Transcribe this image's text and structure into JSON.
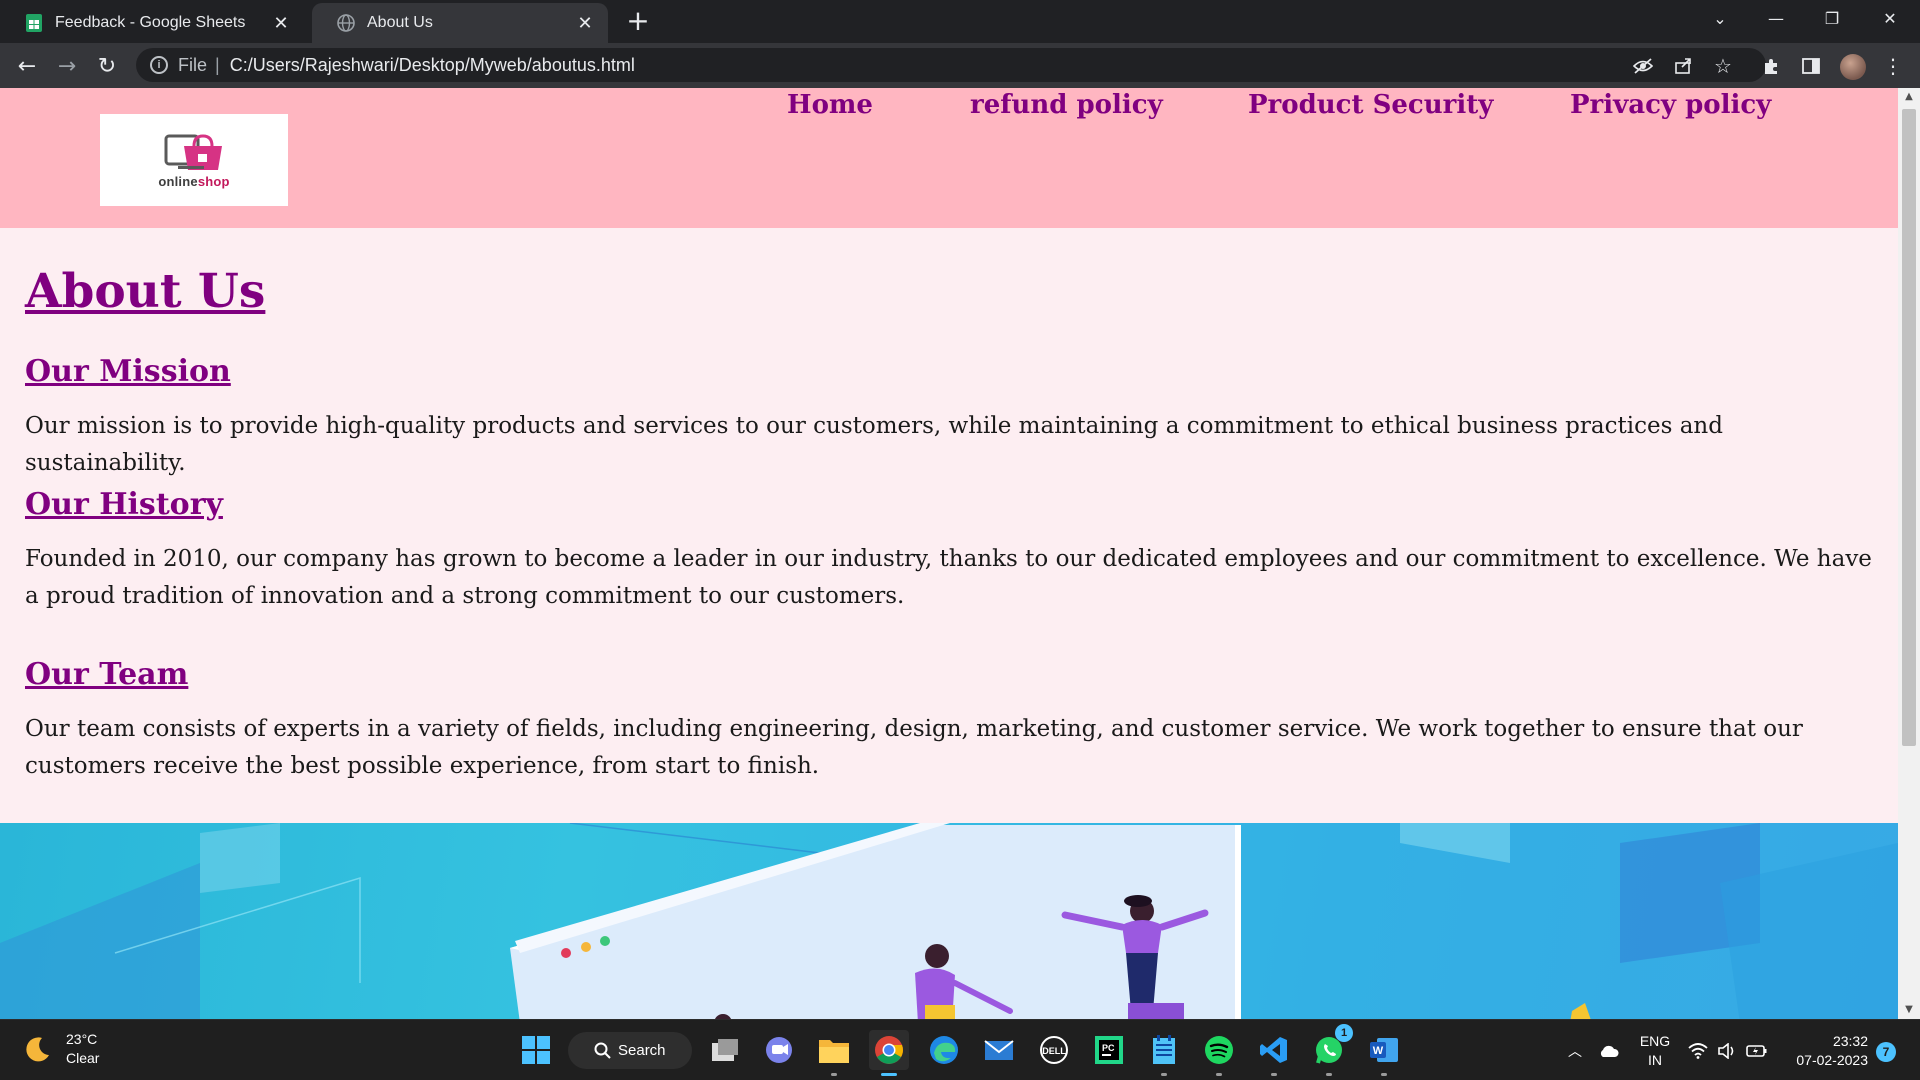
{
  "browser": {
    "tabs": [
      {
        "title": "Feedback - Google Sheets",
        "active": false
      },
      {
        "title": "About Us",
        "active": true
      }
    ],
    "new_tab_symbol": "+",
    "address": {
      "scheme": "File",
      "url": "C:/Users/Rajeshwari/Desktop/Myweb/aboutus.html"
    }
  },
  "site": {
    "logo": {
      "word1": "online",
      "word2": "shop"
    },
    "nav": [
      "Home",
      "refund policy",
      "Product Security",
      "Privacy policy"
    ],
    "colors": {
      "header_bg": "#ffb6c1",
      "page_bg": "#fdeef2",
      "accent": "#800080"
    }
  },
  "content": {
    "title": "About Us",
    "sections": [
      {
        "heading": "Our Mission",
        "text": "Our mission is to provide high-quality products and services to our customers, while maintaining a commitment to ethical business practices and sustainability."
      },
      {
        "heading": "Our History",
        "text": "Founded in 2010, our company has grown to become a leader in our industry, thanks to our dedicated employees and our commitment to excellence. We have a proud tradition of innovation and a strong commitment to our customers."
      },
      {
        "heading": "Our Team",
        "text": "Our team consists of experts in a variety of fields, including engineering, design, marketing, and customer service. We work together to ensure that our customers receive the best possible experience, from start to finish."
      }
    ]
  },
  "taskbar": {
    "weather": {
      "temp": "23°C",
      "condition": "Clear"
    },
    "search_label": "Search",
    "language": {
      "lang": "ENG",
      "region": "IN"
    },
    "time": "23:32",
    "date": "07-02-2023",
    "notification_count": "7",
    "whatsapp_badge": "1"
  }
}
